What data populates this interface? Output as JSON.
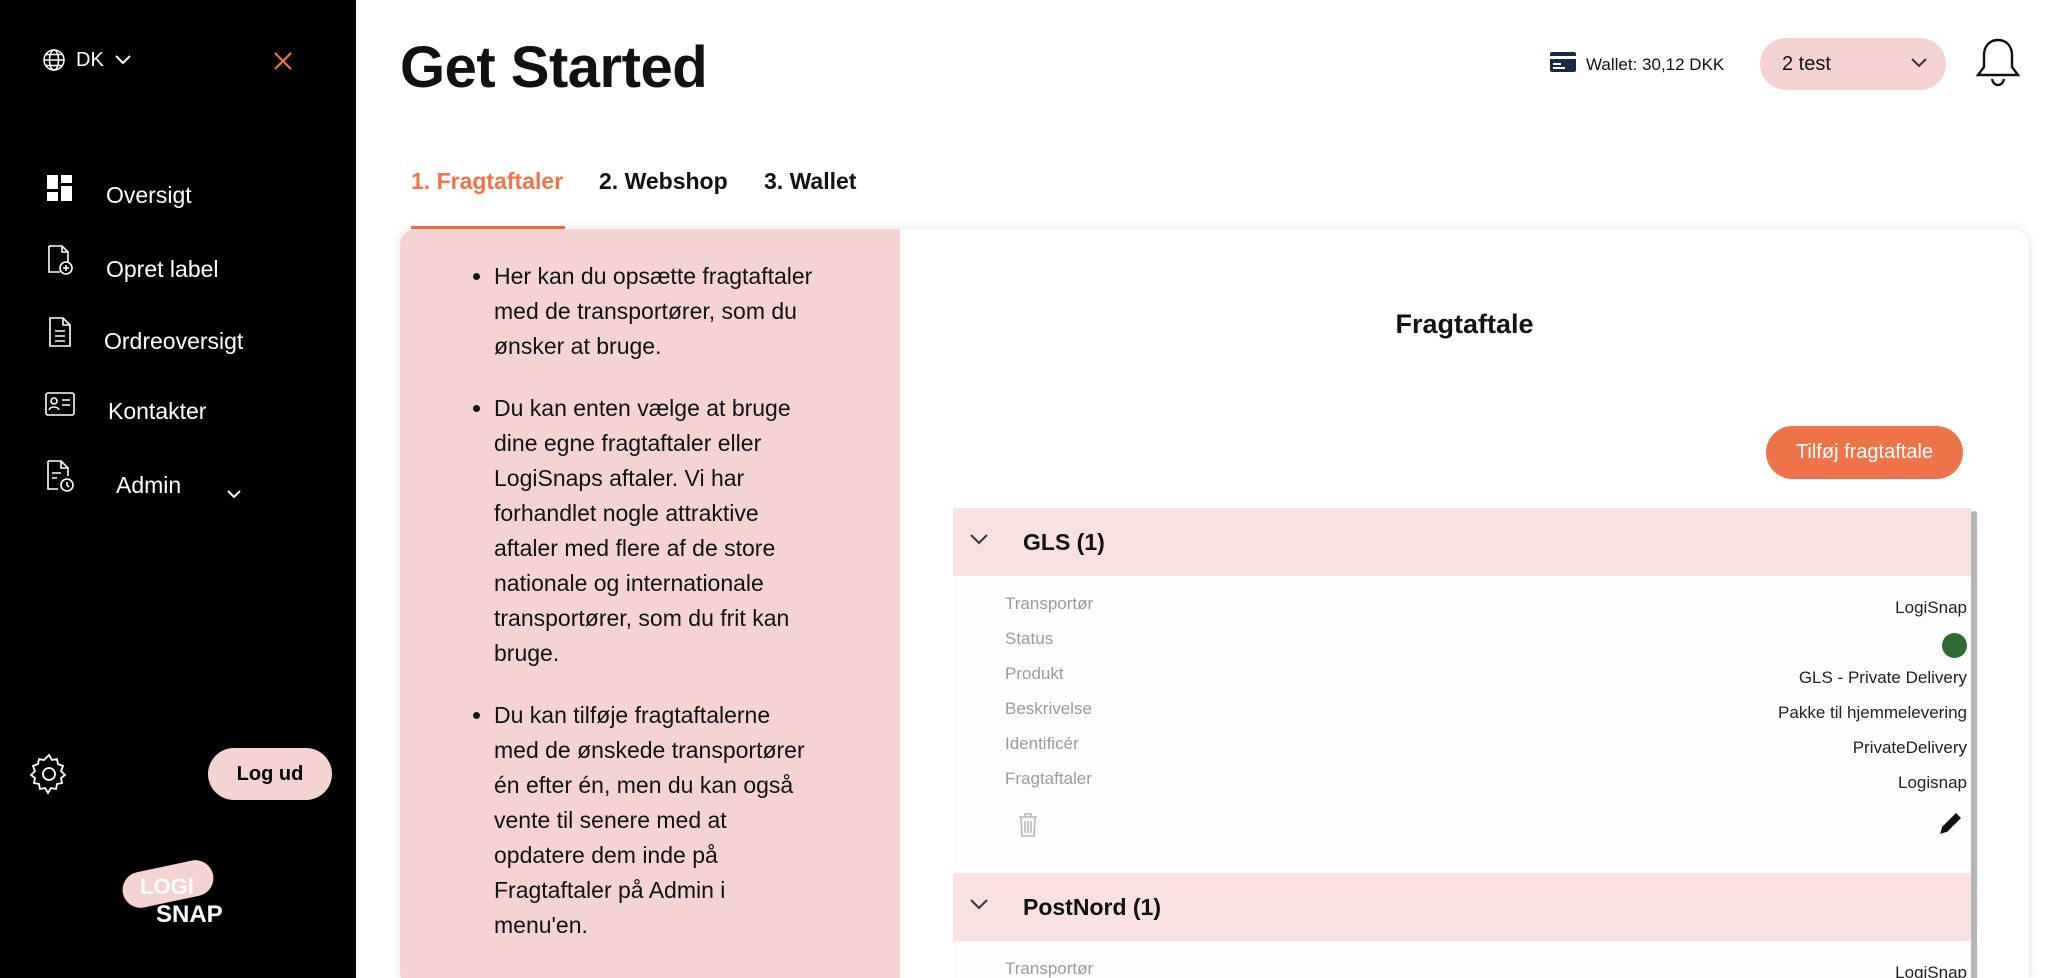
{
  "sidebar": {
    "language": "DK",
    "nav": [
      {
        "label": "Oversigt"
      },
      {
        "label": "Opret label"
      },
      {
        "label": "Ordreoversigt"
      },
      {
        "label": "Kontakter"
      },
      {
        "label": "Admin"
      }
    ],
    "logout_label": "Log ud",
    "logo": {
      "line1": "LOGI",
      "line2": "SNAP"
    }
  },
  "header": {
    "title": "Get Started",
    "wallet": "Wallet: 30,12 DKK",
    "account": "2 test"
  },
  "tabs": [
    {
      "label": "1. Fragtaftaler",
      "active": true
    },
    {
      "label": "2. Webshop",
      "active": false
    },
    {
      "label": "3. Wallet",
      "active": false
    }
  ],
  "info": {
    "bullets": [
      "Her kan du opsætte fragtaftaler med de transportører, som du ønsker at bruge.",
      "Du kan enten vælge at bruge dine egne fragtaftaler eller LogiSnaps aftaler. Vi har forhandlet nogle attraktive aftaler med flere af de store nationale og internationale transportører, som du frit kan bruge.",
      "Du kan tilføje fragtaftalerne med de ønskede transportører én efter én, men du kan også vente til senere med at opdatere dem inde på Fragtaftaler på Admin i menu'en."
    ]
  },
  "agreements": {
    "title": "Fragtaftale",
    "add_label": "Tilføj fragtaftale",
    "groups": [
      {
        "name": "GLS (1)",
        "rows": [
          {
            "key": "Transportør",
            "value": "LogiSnap"
          },
          {
            "key": "Status",
            "value": ""
          },
          {
            "key": "Produkt",
            "value": "GLS - Private Delivery"
          },
          {
            "key": "Beskrivelse",
            "value": "Pakke til hjemmelevering"
          },
          {
            "key": "Identificér",
            "value": "PrivateDelivery"
          },
          {
            "key": "Fragtaftaler",
            "value": "Logisnap"
          }
        ]
      },
      {
        "name": "PostNord (1)",
        "rows": [
          {
            "key": "Transportør",
            "value": "LogiSnap"
          }
        ]
      }
    ]
  },
  "colors": {
    "accent": "#ef7449",
    "pink": "#f6d3d3",
    "status_active": "#2e6b34"
  }
}
